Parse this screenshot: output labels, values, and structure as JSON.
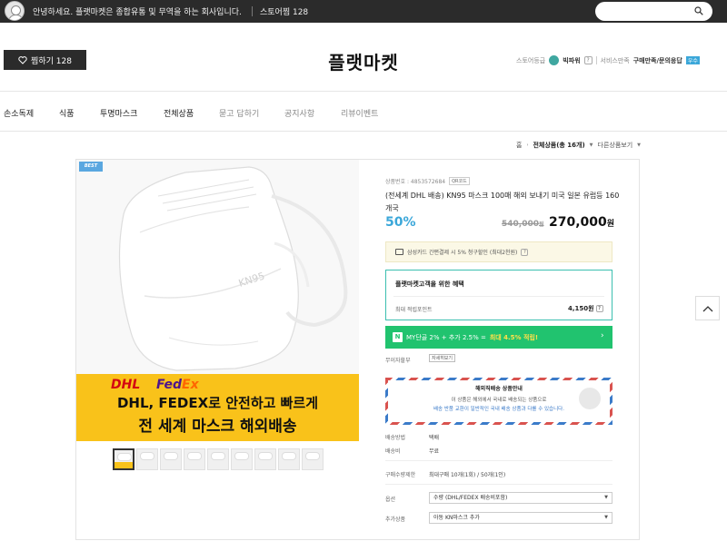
{
  "topbar": {
    "greeting": "안녕하세요. 플랫마켓은 종합유통 및 무역을 하는 회사입니다.",
    "store_like": "스토어찜 128",
    "search_placeholder": ""
  },
  "header": {
    "like_button": "찜하기 128",
    "brand": "플랫마켓",
    "store_grade_label": "스토어등급",
    "store_grade": "빅파워",
    "service_label": "서비스만족",
    "service_links": "구매만족/문의응답",
    "service_badge": "우수"
  },
  "nav": {
    "items": [
      "손소독제",
      "식품",
      "투명마스크",
      "전체상품",
      "묻고 답하기",
      "공지사항",
      "리뷰이벤트"
    ]
  },
  "breadcrumb": {
    "home": "홈",
    "current": "전체상품(총 16개)",
    "other": "다른상품보기"
  },
  "product": {
    "badge": "BEST",
    "banner": {
      "logo_dhl": "DHL",
      "logo_fe": "Fed",
      "logo_ex": "Ex",
      "line1": "DHL, FEDEX로 안전하고 빠르게",
      "line2": "전 세계 마스크 해외배송"
    },
    "id_label": "상품번호 : 4853572684",
    "id_code_button": "QR코드",
    "title": "(전세계 DHL 배송) KN95 마스크 100매 해외 보내기 미국 일본 유럽등 160개국",
    "discount": "50%",
    "original_price": "540,000",
    "original_unit": "원",
    "sale_price": "270,000",
    "sale_unit": "원",
    "card_notice": "삼성카드 간편결제 시 5% 청구할인 (최대2천원)",
    "benefit": {
      "title": "플랫마켓고객을 위한 혜택",
      "point_label": "최대 적립포인트",
      "point_value": "4,150원"
    },
    "mybar": {
      "text1": "MY단골 2% + 추가 2.5% =",
      "highlight": "최대 4.5% 적립!"
    },
    "installment_label": "무이자할부",
    "installment_button": "자세히보기",
    "shipping_notice": {
      "title": "해외직배송 상품안내",
      "line1": "이 상품은 해외에서 국내로 배송되는 상품으로",
      "line2": "배송 반품 교환이 일반적인 국내 배송 상품과 다를 수 있습니다."
    },
    "delivery_method_label": "배송방법",
    "delivery_method": "택배",
    "delivery_fee_label": "배송비",
    "delivery_fee": "무료",
    "limit_label": "구매수량제한",
    "limit_value": "최대구매 10개(1회) / 50개(1인)",
    "option_label": "옵션",
    "option_value": "수량 (DHL/FEDEX 배송비포함)",
    "addon_label": "추가상품",
    "addon_value": "아동 KN마스크 추가"
  }
}
